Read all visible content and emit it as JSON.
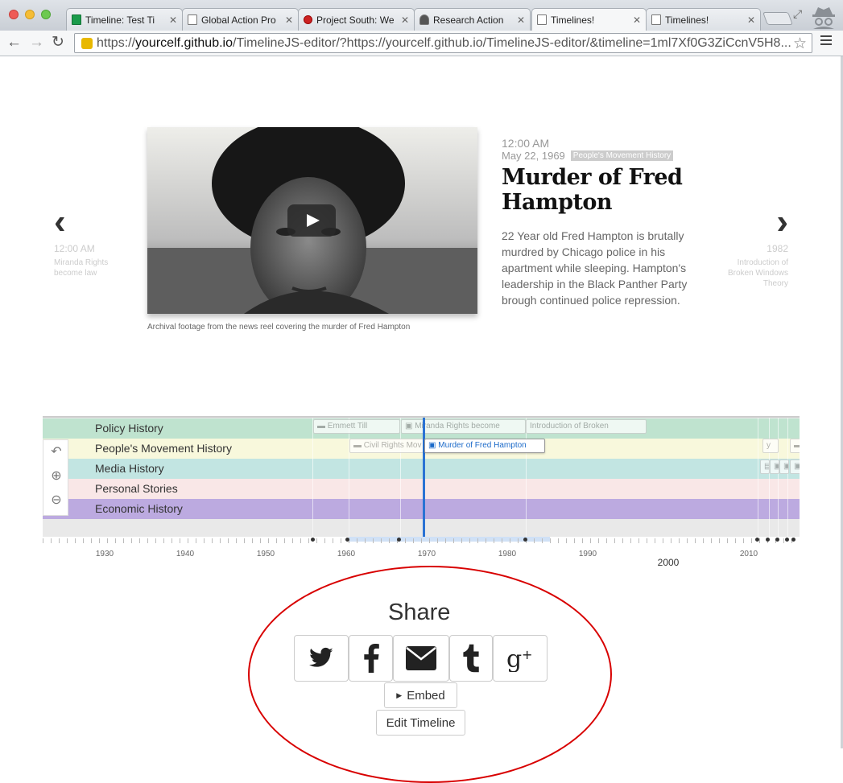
{
  "browser": {
    "tabs": [
      {
        "title": "Timeline: Test Ti",
        "icon": "sheet-icon"
      },
      {
        "title": "Global Action Pro",
        "icon": "page-icon"
      },
      {
        "title": "Project South: We",
        "icon": "site-icon"
      },
      {
        "title": "Research Action",
        "icon": "person-icon"
      },
      {
        "title": "Timelines!",
        "icon": "page-icon"
      },
      {
        "title": "Timelines!",
        "icon": "page-icon"
      }
    ],
    "url_scheme": "https://",
    "url_host": "yourcelf.github.io",
    "url_rest": "/TimelineJS-editor/?https://yourcelf.github.io/TimelineJS-editor/&timeline=1ml7Xf0G3ZiCcnV5H8..."
  },
  "slide": {
    "prev": {
      "time": "12:00 AM",
      "title": "Miranda Rights become law"
    },
    "next": {
      "time": "1982",
      "title": "Introduction of Broken Windows Theory"
    },
    "time": "12:00 AM",
    "date": "May 22, 1969",
    "group": "People's Movement History",
    "headline": "Murder of Fred Hampton",
    "body": "22 Year old Fred Hampton is brutally murdred by Chicago police in his apartment while sleeping. Hampton's leadership in the Black Panther Party brough continued police repression.",
    "caption": "Archival footage from the news reel covering the murder of Fred Hampton"
  },
  "timeline": {
    "bands": [
      {
        "label": "Policy History",
        "color": "#bfe3cf"
      },
      {
        "label": "People's Movement History",
        "color": "#f8f8dc"
      },
      {
        "label": "Media History",
        "color": "#c2e5e2"
      },
      {
        "label": "Personal Stories",
        "color": "#f9e7e7"
      },
      {
        "label": "Economic History",
        "color": "#bcaae0"
      }
    ],
    "markers": [
      {
        "label": "Emmett Till"
      },
      {
        "label": "Civil Rights Mov"
      },
      {
        "label": "Miranda Rights become"
      },
      {
        "label": "Murder of Fred Hampton"
      },
      {
        "label": "Introduction of Broken"
      }
    ],
    "axis_labels": [
      "1930",
      "1940",
      "1950",
      "1960",
      "1970",
      "1980",
      "1990",
      "2010"
    ],
    "major_label": "2000"
  },
  "share": {
    "title": "Share",
    "embed_label": "Embed",
    "edit_label": "Edit Timeline",
    "annotation_color": "#d80000"
  }
}
